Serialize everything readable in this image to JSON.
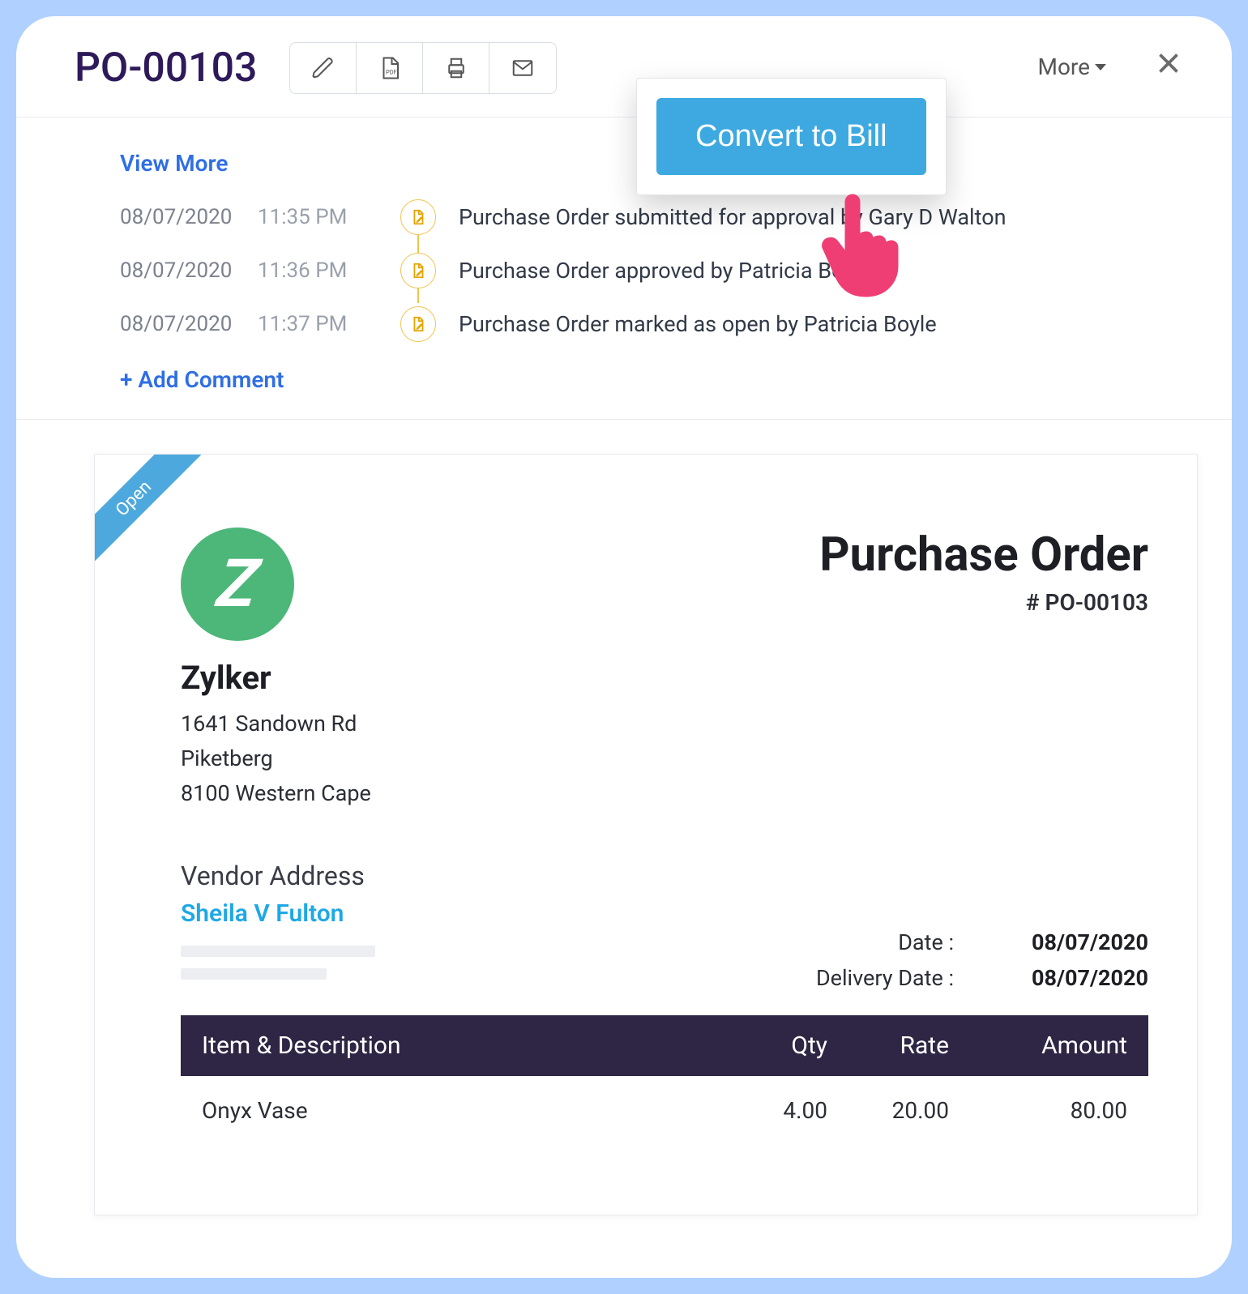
{
  "header": {
    "title": "PO-00103",
    "more_label": "More",
    "convert_label": "Convert to Bill"
  },
  "activity": {
    "view_more": "View More",
    "add_comment": "+  Add Comment",
    "log": [
      {
        "date": "08/07/2020",
        "time": "11:35 PM",
        "msg": "Purchase Order submitted for approval by Gary D Walton"
      },
      {
        "date": "08/07/2020",
        "time": "11:36 PM",
        "msg": "Purchase Order approved by Patricia Boyle"
      },
      {
        "date": "08/07/2020",
        "time": "11:37 PM",
        "msg": "Purchase Order marked as open by Patricia Boyle"
      }
    ]
  },
  "doc": {
    "ribbon": "Open",
    "company_name": "Zylker",
    "company_logo_letter": "Z",
    "address_line1": "1641 Sandown Rd",
    "address_line2": "Piketberg",
    "address_line3": "8100 Western Cape",
    "doc_title": "Purchase Order",
    "doc_number": "# PO-00103",
    "vendor_heading": "Vendor Address",
    "vendor_name": "Sheila V Fulton",
    "date_label": "Date :",
    "date_value": "08/07/2020",
    "delivery_label": "Delivery Date :",
    "delivery_value": "08/07/2020",
    "table": {
      "head_desc": "Item & Description",
      "head_qty": "Qty",
      "head_rate": "Rate",
      "head_amt": "Amount",
      "rows": [
        {
          "desc": "Onyx Vase",
          "qty": "4.00",
          "rate": "20.00",
          "amt": "80.00"
        }
      ]
    }
  }
}
